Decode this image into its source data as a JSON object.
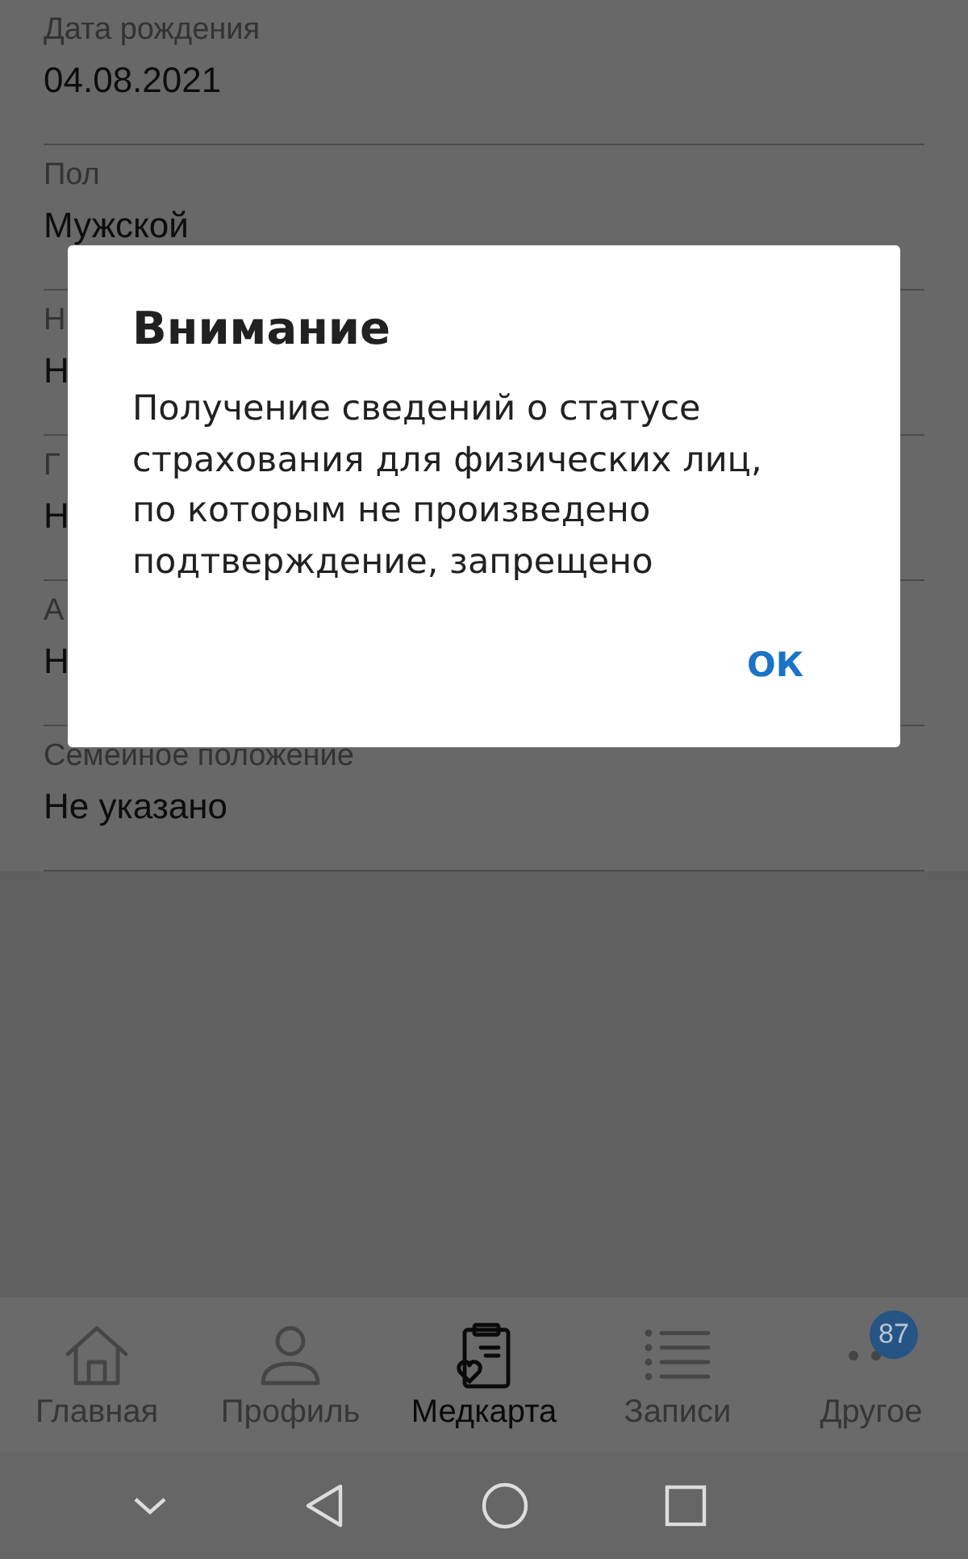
{
  "fields": [
    {
      "label": "Дата рождения",
      "value": "04.08.2021"
    },
    {
      "label": "Пол",
      "value": "Мужской"
    },
    {
      "label": "Н",
      "value": "Н"
    },
    {
      "label": "Г",
      "value": "Н"
    },
    {
      "label": "А",
      "value": "Н"
    },
    {
      "label": "Семейное положение",
      "value": "Не указано"
    }
  ],
  "dialog": {
    "title": "Внимание",
    "message": "Получение сведений о статусе страхования для физических лиц, по которым не произведено подтверждение, запрещено",
    "button": "ОК"
  },
  "bottom_nav": [
    {
      "label": "Главная",
      "kind": "home",
      "selected": false
    },
    {
      "label": "Профиль",
      "kind": "profile",
      "selected": false
    },
    {
      "label": "Медкарта",
      "kind": "medcard",
      "selected": true
    },
    {
      "label": "Записи",
      "kind": "list",
      "selected": false
    },
    {
      "label": "Другое",
      "kind": "more",
      "selected": false,
      "badge": "87"
    }
  ]
}
